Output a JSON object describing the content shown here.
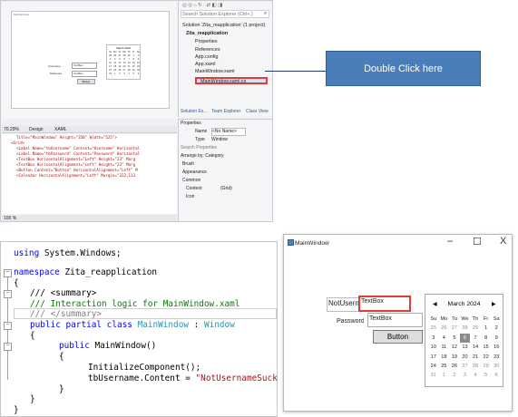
{
  "vs": {
    "designer": {
      "window_title": "MainWindow",
      "username_label": "Username",
      "password_label": "Password",
      "textbox1": "TextBox",
      "textbox2": "TextBox",
      "button": "Button",
      "calendar_header": "March 2024",
      "calendar_cells": [
        "Su",
        "Mo",
        "Tu",
        "We",
        "Th",
        "Fr",
        "Sa",
        "25",
        "26",
        "27",
        "28",
        "29",
        "1",
        "2",
        "3",
        "4",
        "5",
        "6",
        "7",
        "8",
        "9",
        "10",
        "11",
        "12",
        "13",
        "14",
        "15",
        "16",
        "17",
        "18",
        "19",
        "20",
        "21",
        "22",
        "23",
        "24",
        "25",
        "26",
        "27",
        "28",
        "29",
        "30",
        "31",
        "1",
        "2",
        "3",
        "4",
        "5",
        "6"
      ]
    },
    "solution_explorer": {
      "search_placeholder": "Search Solution Explorer (Ctrl+;)",
      "items": [
        "Solution 'Zita_reapplication' (1 project)",
        "Zita_reapplication",
        "Properties",
        "References",
        "App.config",
        "App.xaml",
        "MainWindow.xaml",
        "MainWindow.xaml.cs"
      ],
      "tabs": [
        "Solution Ex...",
        "Team Explorer",
        "Class View"
      ]
    },
    "properties": {
      "title": "Properties",
      "name_label": "Name",
      "name_value": "<No Name>",
      "type_label": "Type",
      "type_value": "Window",
      "search_placeholder": "Search Properties",
      "arrange": "Arrange by: Category",
      "categories": [
        "Brush",
        "Appearance",
        "Common"
      ],
      "content_label": "Content",
      "content_value": "(Grid)",
      "icon_label": "Icon"
    },
    "xaml": {
      "zoom": "70.29%",
      "design_tab": "Design",
      "xaml_tab": "XAML",
      "lines": [
        "Title=\"MainWindow\" Height=\"350\" Width=\"525\">",
        "<Grid>",
        "<Label Name=\"tbUsername\" Content=\"Username\" Horizontal",
        "<Label Name=\"tbPassword\" Content=\"Password\" Horizontal",
        "<TextBox HorizontalAlignment=\"Left\" Height=\"23\" Marg",
        "<TextBox HorizontalAlignment=\"Left\" Height=\"23\" Marg",
        "<Button Content=\"Button\" HorizontalAlignment=\"Left\" M",
        "<Calendar HorizontalAlignment=\"Left\" Margin=\"322,113"
      ],
      "footer_zoom": "100 %"
    }
  },
  "callout": {
    "text": "Double Click here"
  },
  "code": {
    "using_kw": "using",
    "using_ns": " System.Windows;",
    "namespace_kw": "namespace",
    "namespace_name": " Zita_reapplication",
    "brace_open": "{",
    "brace_close": "}",
    "summary_open": "/// <summary>",
    "summary_text": "/// Interaction logic for MainWindow.xaml",
    "summary_close": "/// </summary>",
    "class_kw1": "public",
    "class_kw2": " partial",
    "class_kw3": " class",
    "class_name": " MainWindow",
    "class_colon": " : ",
    "class_base": "Window",
    "ctor_kw": "public",
    "ctor_name": " MainWindow()",
    "init_call": "InitializeComponent();",
    "assign_left": "tbUsername.Content = ",
    "assign_str": "\"NotUsernameSucker!\"",
    "assign_end": ";"
  },
  "runwin": {
    "title": "MainWindow",
    "minimize": "–",
    "maximize": "☐",
    "close": "X",
    "username_label": "NotUsernam",
    "textbox1": "TextBox",
    "password_label": "Password",
    "textbox2": "TextBox",
    "button": "Button",
    "calendar_header": "March 2024",
    "calendar_prev": "◀",
    "calendar_next": "▶",
    "calendar_cells": [
      "Su",
      "Mo",
      "Tu",
      "We",
      "Th",
      "Fr",
      "Sa",
      "25",
      "26",
      "27",
      "28",
      "29",
      "1",
      "2",
      "3",
      "4",
      "5",
      "6",
      "7",
      "8",
      "9",
      "10",
      "11",
      "12",
      "13",
      "14",
      "15",
      "16",
      "17",
      "18",
      "19",
      "20",
      "21",
      "22",
      "23",
      "24",
      "25",
      "26",
      "27",
      "28",
      "29",
      "30",
      "31",
      "1",
      "2",
      "3",
      "4",
      "5",
      "6"
    ],
    "today_index": 17
  },
  "colors": {
    "callout_bg": "#4a7ebb",
    "highlight_red": "#e53935",
    "arrow_fill": "#ffff00"
  }
}
